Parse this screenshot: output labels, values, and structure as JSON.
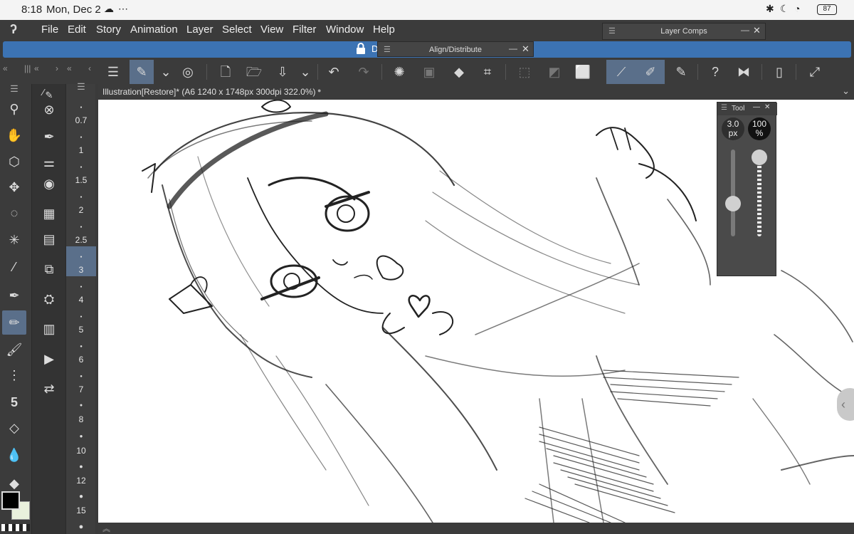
{
  "status": {
    "time": "8:18",
    "date": "Mon, Dec 2",
    "extra_icons": [
      "cloud-icon",
      "more-icon"
    ],
    "right_icons": [
      "bluetooth-icon",
      "moon-icon",
      "wifi-icon"
    ],
    "battery": "87"
  },
  "menu": {
    "items": [
      "File",
      "Edit",
      "Story",
      "Animation",
      "Layer",
      "Select",
      "View",
      "Filter",
      "Window",
      "Help"
    ]
  },
  "panels": {
    "layer_comps": "Layer Comps",
    "align_distribute": "Align/Distribute",
    "tool_property": "Tool"
  },
  "doc_bar": {
    "letter": "D"
  },
  "canvas": {
    "tab_title": "Illustration[Restore]* (A6 1240 x 1748px 300dpi 322.0%)",
    "tab_marker": "●"
  },
  "brush_sizes": [
    "0.7",
    "1",
    "1.5",
    "2",
    "2.5",
    "3",
    "4",
    "5",
    "6",
    "7",
    "8",
    "10",
    "12",
    "15"
  ],
  "selected_brush_size": "3",
  "tool_property": {
    "size_value": "3.0",
    "size_unit": "px",
    "opacity_value": "100",
    "opacity_unit": "%",
    "size_level": 0.35,
    "opacity_level": 1.0
  },
  "colors": {
    "main": "#000000",
    "sub": "#e9f0dc",
    "accent": "#3c73b3",
    "active_tool_bg": "#5a6f8a"
  },
  "glyphs": {
    "logo": "ʔ",
    "lock": "🔒",
    "grip": "☰",
    "minimize": "—",
    "close": "✕",
    "chevron_down": "⌄",
    "collapse_left": "«",
    "collapse_right": "‹",
    "expand_up": "≈",
    "side_handle": "‹"
  }
}
